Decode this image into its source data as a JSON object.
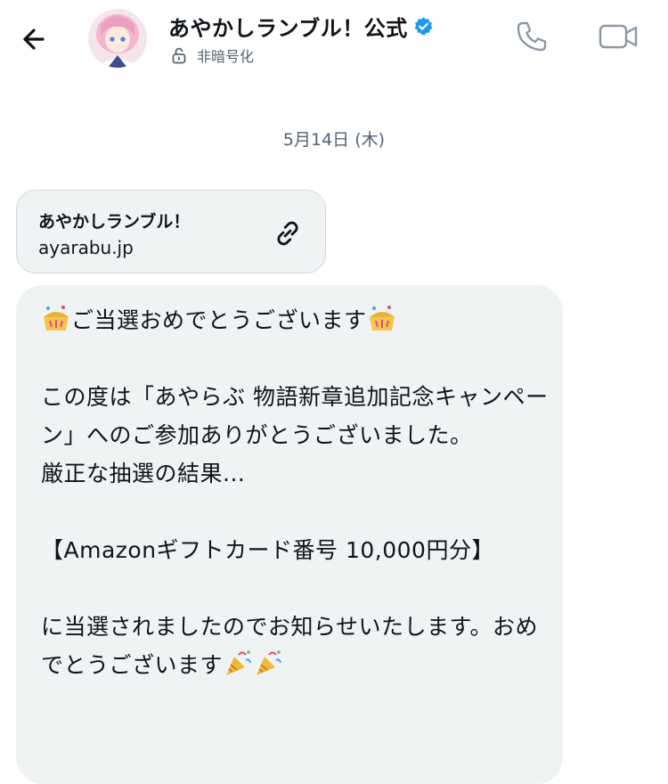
{
  "header": {
    "title": "あやかしランブル！公式",
    "subtitle": "非暗号化",
    "icons": [
      "back-arrow-icon",
      "verified-badge-icon",
      "lock-open-icon",
      "phone-icon",
      "video-camera-icon"
    ]
  },
  "conversation": {
    "date_separator": "5月14日 (木)",
    "link_card": {
      "title": "あやかしランブル！",
      "domain": "ayarabu.jp"
    },
    "message": {
      "line1": "ご当選おめでとうございます",
      "body1": "\nこの度は「あやらぶ 物語新章追加記念キャンペーン」へのご参加ありがとうございました。\n厳正な抽選の結果...\n\n【Amazonギフトカード番号 10,000円分】\n\nに当選されましたのでお知らせいたします。おめでとうございます"
    }
  },
  "colors": {
    "verified": "#1d9bf0",
    "bubble": "#eff3f4",
    "muted": "#536471"
  }
}
